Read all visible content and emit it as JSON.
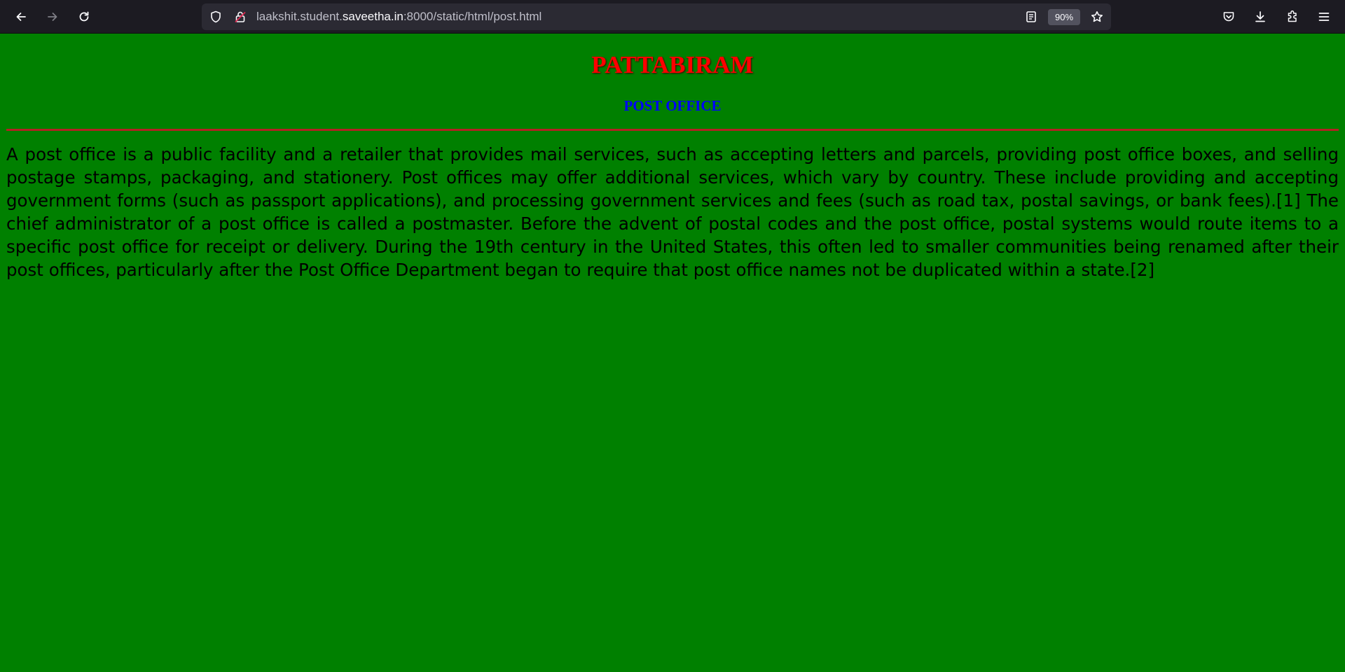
{
  "browser": {
    "url_prefix": "laakshit.student.",
    "url_domain": "saveetha.in",
    "url_suffix": ":8000/static/html/post.html",
    "zoom": "90%",
    "icons": [
      "back-icon",
      "forward-icon",
      "reload-icon",
      "shield-icon",
      "insecure-lock-icon",
      "reader-view-icon",
      "bookmark-star-icon",
      "pocket-icon",
      "downloads-icon",
      "extensions-icon",
      "menu-icon"
    ]
  },
  "page": {
    "heading": "PATTABIRAM",
    "subheading": "POST OFFICE",
    "paragraph": "A post office is a public facility and a retailer that provides mail services, such as accepting letters and parcels, providing post office boxes, and selling postage stamps, packaging, and stationery. Post offices may offer additional services, which vary by country. These include providing and accepting government forms (such as passport applications), and processing government services and fees (such as road tax, postal savings, or bank fees).[1] The chief administrator of a post office is called a postmaster. Before the advent of postal codes and the post office, postal systems would route items to a specific post office for receipt or delivery. During the 19th century in the United States, this often led to smaller communities being renamed after their post offices, particularly after the Post Office Department began to require that post office names not be duplicated within a state.[2]"
  },
  "colors": {
    "page_background": "#008000",
    "heading": "#ff0000",
    "subheading": "#0000ff",
    "rule": "#b22222",
    "toolbar": "#1c1b22"
  }
}
